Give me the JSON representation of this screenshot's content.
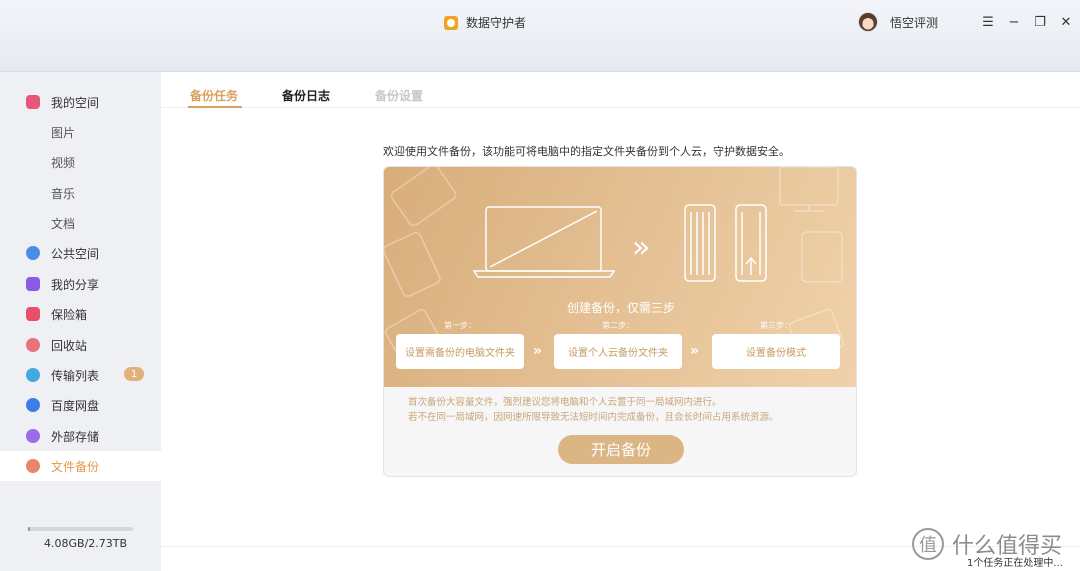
{
  "app": {
    "title": "数据守护者",
    "logo_icon": "app-logo-icon"
  },
  "user": {
    "name": "悟空评测"
  },
  "window_controls": {
    "menu": "☰",
    "minimize": "−",
    "restore": "❐",
    "close": "✕"
  },
  "sidebar": {
    "items": [
      {
        "label": "我的空间",
        "icon": "my-space-icon",
        "color": "#e9567a"
      },
      {
        "label": "图片"
      },
      {
        "label": "视频"
      },
      {
        "label": "音乐"
      },
      {
        "label": "文档"
      },
      {
        "label": "公共空间",
        "icon": "public-space-icon",
        "color": "#4a8de8"
      },
      {
        "label": "我的分享",
        "icon": "my-share-icon",
        "color": "#8a5be6"
      },
      {
        "label": "保险箱",
        "icon": "safe-box-icon",
        "color": "#e94f6a"
      },
      {
        "label": "回收站",
        "icon": "recycle-bin-icon",
        "color": "#e9727a"
      },
      {
        "label": "传输列表",
        "icon": "transfer-list-icon",
        "color": "#3fa9e0",
        "badge": "1"
      },
      {
        "label": "百度网盘",
        "icon": "baidu-netdisk-icon",
        "color": "#3a7ee6"
      },
      {
        "label": "外部存储",
        "icon": "external-storage-icon",
        "color": "#9b6be8"
      },
      {
        "label": "文件备份",
        "icon": "file-backup-icon",
        "color": "#e9866a",
        "active": true
      }
    ],
    "storage": {
      "text": "4.08GB/2.73TB",
      "used_fraction": 0.0015
    }
  },
  "tabs": [
    {
      "label": "备份任务",
      "state": "active"
    },
    {
      "label": "备份日志",
      "state": "normal"
    },
    {
      "label": "备份设置",
      "state": "disabled"
    }
  ],
  "intro": "欢迎使用文件备份，该功能可将电脑中的指定文件夹备份到个人云，守护数据安全。",
  "hero": {
    "title": "创建备份，仅需三步",
    "steps": [
      {
        "label": "第一步：",
        "text": "设置需备份的电脑文件夹"
      },
      {
        "label": "第二步：",
        "text": "设置个人云备份文件夹"
      },
      {
        "label": "第三步：",
        "text": "设置备份模式"
      }
    ],
    "arrow": "»",
    "illustration_arrow": "»"
  },
  "notes": [
    "首次备份大容量文件，强烈建议您将电脑和个人云置于同一局域网内进行。",
    "若不在同一局域网，因网速所限导致无法短时间内完成备份，且会长时间占用系统资源。"
  ],
  "start_button": "开启备份",
  "status": "1个任务正在处理中...",
  "watermark": {
    "text": "什么值得买",
    "icon": "值"
  },
  "colors": {
    "accent": "#d9a15f",
    "hero_start": "#d8ad7a",
    "hero_end": "#f0d2aa"
  }
}
